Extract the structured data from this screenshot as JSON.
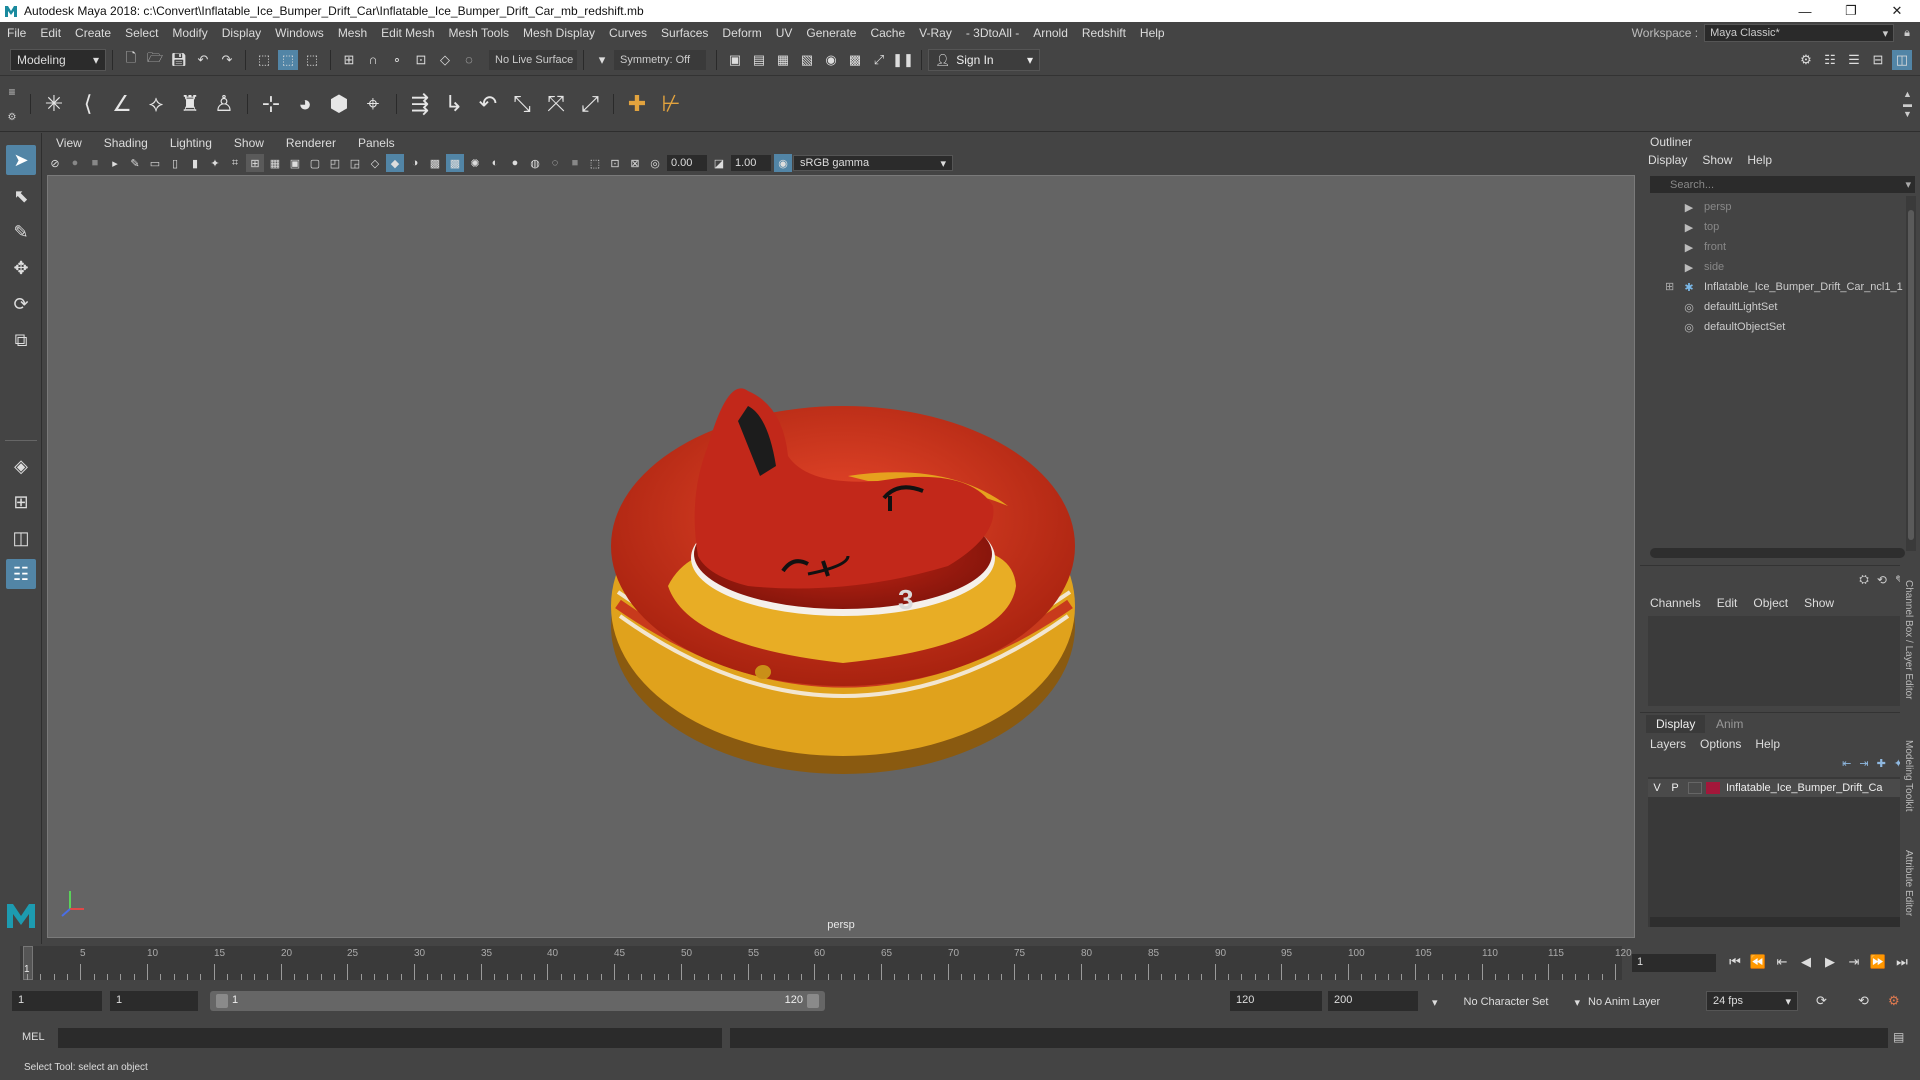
{
  "titlebar": {
    "title": "Autodesk Maya 2018: c:\\Convert\\Inflatable_Ice_Bumper_Drift_Car\\Inflatable_Ice_Bumper_Drift_Car_mb_redshift.mb",
    "minimize": "—",
    "maximize": "❐",
    "close": "✕"
  },
  "menubar": {
    "items": [
      "File",
      "Edit",
      "Create",
      "Select",
      "Modify",
      "Display",
      "Windows",
      "Mesh",
      "Edit Mesh",
      "Mesh Tools",
      "Mesh Display",
      "Curves",
      "Surfaces",
      "Deform",
      "UV",
      "Generate",
      "Cache",
      "V-Ray",
      "- 3DtoAll -",
      "Arnold",
      "Redshift",
      "Help"
    ],
    "workspace_label": "Workspace :",
    "workspace_value": "Maya Classic*"
  },
  "statusline": {
    "menuset": "Modeling",
    "live_surface": "No Live Surface",
    "symmetry": "Symmetry: Off",
    "sign_in": "Sign In"
  },
  "panel": {
    "menus": [
      "View",
      "Shading",
      "Lighting",
      "Show",
      "Renderer",
      "Panels"
    ],
    "exposure": "0.00",
    "gamma": "1.00",
    "color_space": "sRGB gamma",
    "camera": "persp"
  },
  "outliner": {
    "title": "Outliner",
    "menus": [
      "Display",
      "Show",
      "Help"
    ],
    "search_placeholder": "Search...",
    "items": [
      {
        "label": "persp",
        "icon": "camera-icon",
        "dim": true
      },
      {
        "label": "top",
        "icon": "camera-icon",
        "dim": true
      },
      {
        "label": "front",
        "icon": "camera-icon",
        "dim": true
      },
      {
        "label": "side",
        "icon": "camera-icon",
        "dim": true
      },
      {
        "label": "Inflatable_Ice_Bumper_Drift_Car_ncl1_1",
        "icon": "transform-icon",
        "dim": false
      },
      {
        "label": "defaultLightSet",
        "icon": "set-icon",
        "dim": false
      },
      {
        "label": "defaultObjectSet",
        "icon": "set-icon",
        "dim": false
      }
    ]
  },
  "channelbox": {
    "menus": [
      "Channels",
      "Edit",
      "Object",
      "Show"
    ]
  },
  "layereditor": {
    "tabs": [
      "Display",
      "Anim"
    ],
    "menus": [
      "Layers",
      "Options",
      "Help"
    ],
    "layer": {
      "v": "V",
      "p": "P",
      "name": "Inflatable_Ice_Bumper_Drift_Ca",
      "color": "#a3173a"
    }
  },
  "side_tabs": [
    "Channel Box / Layer Editor",
    "Modeling Toolkit",
    "Attribute Editor"
  ],
  "timeline": {
    "ticks": [
      "5",
      "10",
      "15",
      "20",
      "25",
      "30",
      "35",
      "40",
      "45",
      "50",
      "55",
      "60",
      "65",
      "70",
      "75",
      "80",
      "85",
      "90",
      "95",
      "100",
      "105",
      "110",
      "115",
      "120"
    ],
    "current": "1",
    "current_frame_field": "1"
  },
  "range": {
    "start": "1",
    "playback_start": "1",
    "slider_start": "1",
    "slider_end": "120",
    "playback_end": "120",
    "end": "200",
    "character_set": "No Character Set",
    "anim_layer": "No Anim Layer",
    "fps": "24 fps"
  },
  "command": {
    "label": "MEL",
    "help": "Select Tool: select an object"
  },
  "model": {
    "seat_number": "3"
  }
}
